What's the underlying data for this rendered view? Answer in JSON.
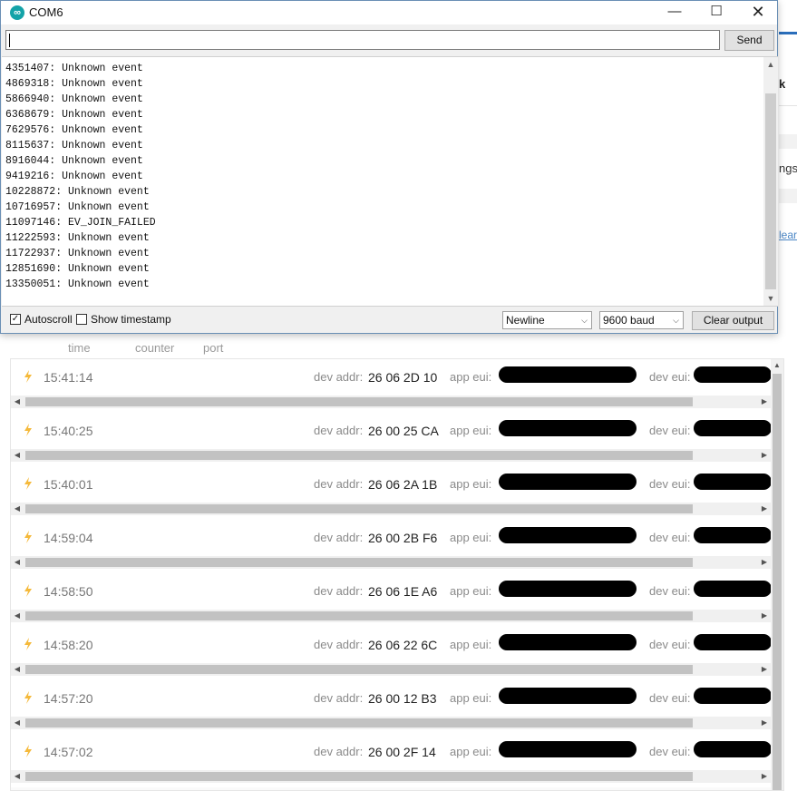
{
  "serial_window": {
    "title": "COM6",
    "input_value": "",
    "send_label": "Send",
    "output_lines": [
      "4351407: Unknown event",
      "4869318: Unknown event",
      "5866940: Unknown event",
      "6368679: Unknown event",
      "7629576: Unknown event",
      "8115637: Unknown event",
      "8916044: Unknown event",
      "9419216: Unknown event",
      "10228872: Unknown event",
      "10716957: Unknown event",
      "11097146: EV_JOIN_FAILED",
      "11222593: Unknown event",
      "11722937: Unknown event",
      "12851690: Unknown event",
      "13350051: Unknown event"
    ],
    "autoscroll_label": "Autoscroll",
    "autoscroll_checked": true,
    "timestamp_label": "Show timestamp",
    "timestamp_checked": false,
    "line_ending": "Newline",
    "baud": "9600 baud",
    "clear_label": "Clear output",
    "controls": {
      "minimize": "—",
      "maximize": "☐",
      "close": "✕",
      "check_mark": "✓",
      "dropdown": "⌵",
      "scroll_up": "▲",
      "scroll_down": "▼"
    }
  },
  "background": {
    "partial_texts": {
      "k": "k",
      "ngs": "ngs",
      "lear": "lear"
    },
    "columns": {
      "time": "time",
      "counter": "counter",
      "port": "port"
    },
    "labels": {
      "dev_addr": "dev addr:",
      "app_eui": "app eui:",
      "dev_eui": "dev eui:"
    },
    "icons": {
      "left_arrow": "◀",
      "right_arrow": "▶",
      "up_arrow": "▲"
    },
    "accent_color": "#2a6ebb",
    "bolt_color": "#f5b93a",
    "events": [
      {
        "time": "15:41:14",
        "dev_addr": "26 06 2D 10"
      },
      {
        "time": "15:40:25",
        "dev_addr": "26 00 25 CA"
      },
      {
        "time": "15:40:01",
        "dev_addr": "26 06 2A 1B"
      },
      {
        "time": "14:59:04",
        "dev_addr": "26 00 2B F6"
      },
      {
        "time": "14:58:50",
        "dev_addr": "26 06 1E A6"
      },
      {
        "time": "14:58:20",
        "dev_addr": "26 06 22 6C"
      },
      {
        "time": "14:57:20",
        "dev_addr": "26 00 12 B3"
      },
      {
        "time": "14:57:02",
        "dev_addr": "26 00 2F 14"
      }
    ]
  }
}
